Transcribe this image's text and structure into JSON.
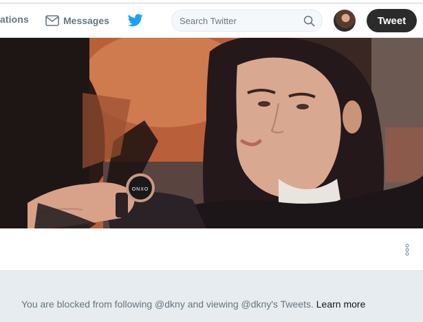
{
  "nav": {
    "notifications_label": "ations",
    "messages_label": "Messages",
    "twitter_logo": "twitter-bird-icon"
  },
  "search": {
    "placeholder": "Search Twitter",
    "value": "",
    "icon": "search-icon"
  },
  "tweet_button_label": "Tweet",
  "colors": {
    "tweet_button_bg": "#2b2b2b",
    "twitter_blue": "#1da1f2",
    "page_bg": "#e6ecf0",
    "muted_text": "#66757f"
  },
  "profile": {
    "more_icon": "vertical-ellipsis-icon"
  },
  "blocked": {
    "message": "You are blocked from following @dkny and viewing @dkny's Tweets.",
    "learn_more_label": "Learn more"
  }
}
